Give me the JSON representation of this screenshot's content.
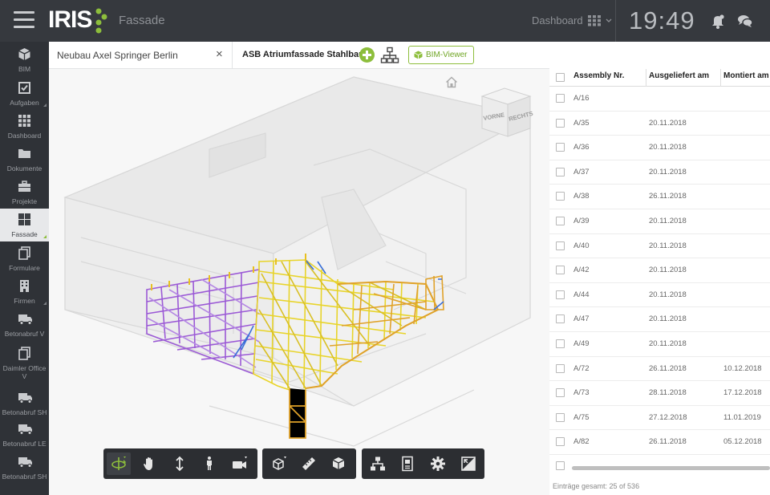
{
  "header": {
    "logo_text": "IRIS",
    "app_name": "Fassade",
    "dashboard_label": "Dashboard",
    "clock": "19:49"
  },
  "sidebar": {
    "items": [
      {
        "label": "BIM",
        "icon": "cube-icon"
      },
      {
        "label": "Aufgaben",
        "icon": "checkbox-icon"
      },
      {
        "label": "Dashboard",
        "icon": "grid-icon"
      },
      {
        "label": "Dokumente",
        "icon": "folder-icon"
      },
      {
        "label": "Projekte",
        "icon": "briefcase-icon"
      },
      {
        "label": "Fassade",
        "icon": "facade-grid-icon"
      },
      {
        "label": "Formulare",
        "icon": "forms-icon"
      },
      {
        "label": "Firmen",
        "icon": "building-icon"
      },
      {
        "label": "Betonabruf V",
        "icon": "truck-icon"
      },
      {
        "label": "Daimler Office V",
        "icon": "copy-icon"
      },
      {
        "label": "Betonabruf SH",
        "icon": "truck-icon"
      },
      {
        "label": "Betonabruf LE",
        "icon": "truck-icon"
      },
      {
        "label": "Betonabruf SH",
        "icon": "truck-icon"
      }
    ],
    "active": "Fassade"
  },
  "tabs": {
    "project": "Neubau Axel Springer Berlin",
    "close": "×",
    "facade": "ASB Atriumfassade Stahlbau",
    "bim_viewer": "BIM-Viewer"
  },
  "viewcube": {
    "front": "VORNE",
    "right": "RECHTS"
  },
  "colors": {
    "accent": "#8dbe3c",
    "topbar": "#36393e",
    "sidebar": "#2f3237",
    "mesh_purple": "#9b59d6",
    "mesh_yellow": "#e8d42a",
    "mesh_orange": "#e0a22a",
    "mesh_blue": "#3a6fd8"
  },
  "table": {
    "columns": [
      "Assembly Nr.",
      "Ausgeliefert am",
      "Montiert am"
    ],
    "rows": [
      {
        "nr": "A/16",
        "delivered": "",
        "mounted": ""
      },
      {
        "nr": "A/35",
        "delivered": "20.11.2018",
        "mounted": ""
      },
      {
        "nr": "A/36",
        "delivered": "20.11.2018",
        "mounted": ""
      },
      {
        "nr": "A/37",
        "delivered": "20.11.2018",
        "mounted": ""
      },
      {
        "nr": "A/38",
        "delivered": "26.11.2018",
        "mounted": ""
      },
      {
        "nr": "A/39",
        "delivered": "20.11.2018",
        "mounted": ""
      },
      {
        "nr": "A/40",
        "delivered": "20.11.2018",
        "mounted": ""
      },
      {
        "nr": "A/42",
        "delivered": "20.11.2018",
        "mounted": ""
      },
      {
        "nr": "A/44",
        "delivered": "20.11.2018",
        "mounted": ""
      },
      {
        "nr": "A/47",
        "delivered": "20.11.2018",
        "mounted": ""
      },
      {
        "nr": "A/49",
        "delivered": "20.11.2018",
        "mounted": ""
      },
      {
        "nr": "A/72",
        "delivered": "26.11.2018",
        "mounted": "10.12.2018"
      },
      {
        "nr": "A/73",
        "delivered": "28.11.2018",
        "mounted": "17.12.2018"
      },
      {
        "nr": "A/75",
        "delivered": "27.12.2018",
        "mounted": "11.01.2019"
      },
      {
        "nr": "A/82",
        "delivered": "26.11.2018",
        "mounted": "05.12.2018"
      }
    ],
    "footer": "Einträge gesamt: 25 of 536"
  },
  "toolbar": {
    "groups": [
      [
        "orbit-icon",
        "pan-hand-icon",
        "zoom-arrows-icon",
        "walk-person-icon",
        "camera-icon"
      ],
      [
        "explode-cube-icon",
        "measure-ruler-icon",
        "section-box-icon"
      ],
      [
        "model-tree-icon",
        "properties-icon",
        "settings-gear-icon",
        "fullscreen-icon"
      ]
    ]
  }
}
